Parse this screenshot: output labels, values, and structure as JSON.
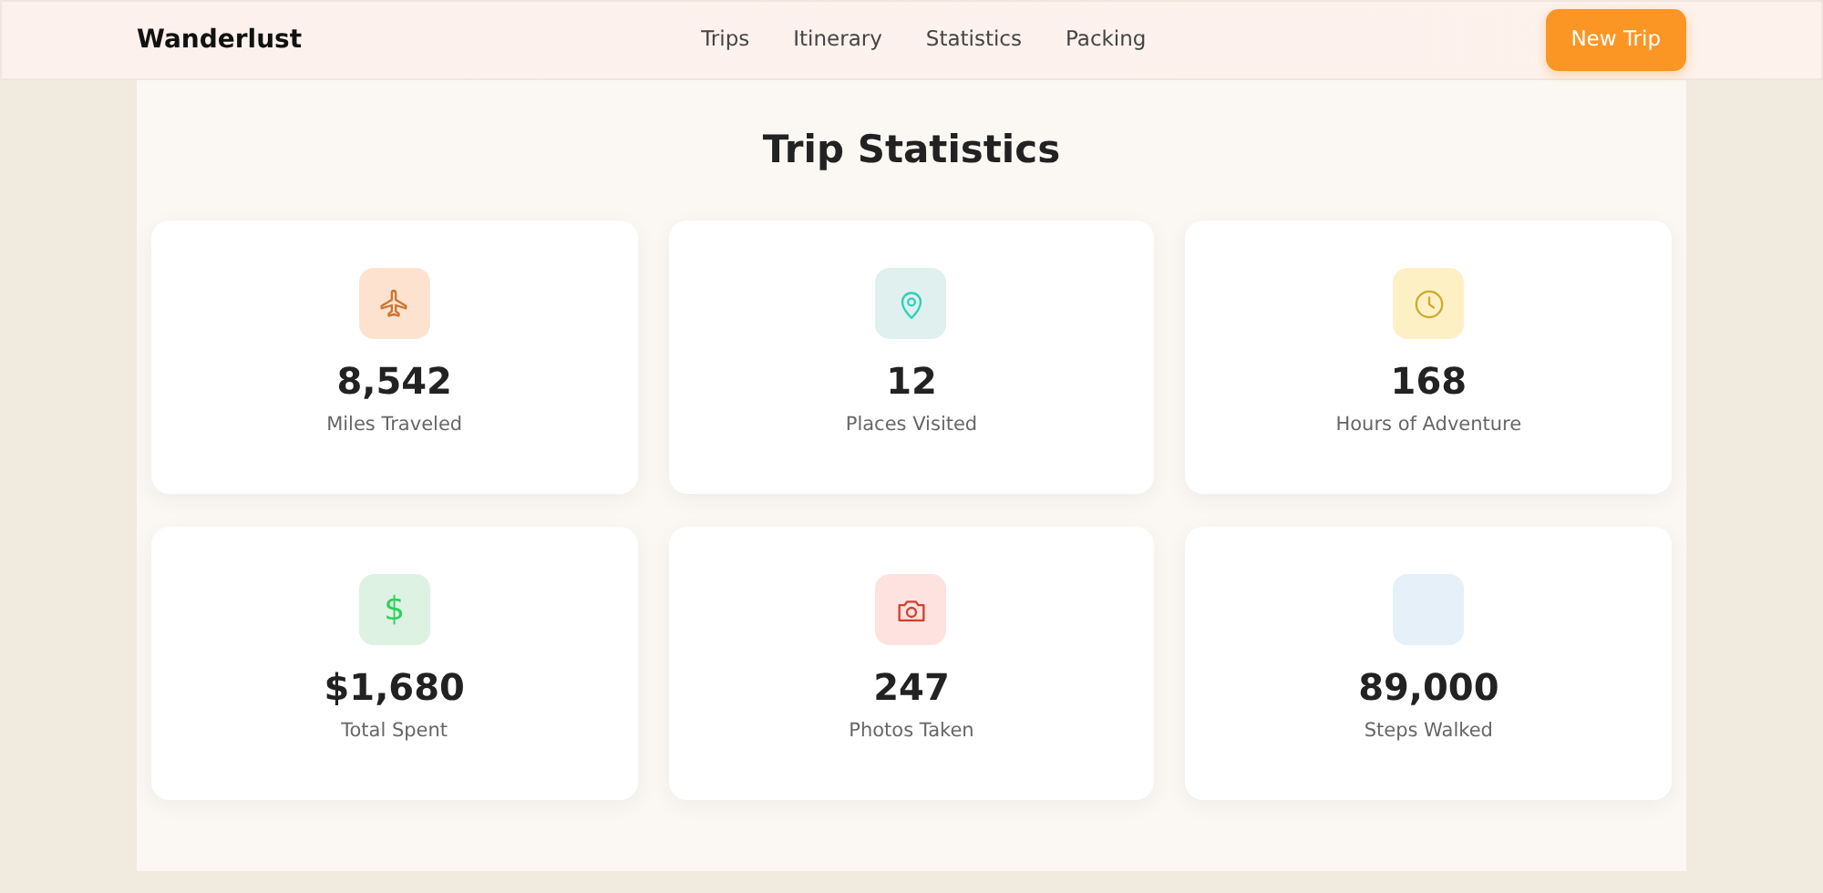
{
  "brand": "Wanderlust",
  "nav": [
    {
      "label": "Trips"
    },
    {
      "label": "Itinerary"
    },
    {
      "label": "Statistics"
    },
    {
      "label": "Packing"
    }
  ],
  "cta": "New Trip",
  "title": "Trip Statistics",
  "stats": [
    {
      "kind": "plane",
      "color": "#fde3cf",
      "value": "8,542",
      "label": "Miles Traveled"
    },
    {
      "kind": "pin",
      "color": "#dff0ee",
      "value": "12",
      "label": "Places Visited"
    },
    {
      "kind": "clock",
      "color": "#fdf0c4",
      "value": "168",
      "label": "Hours of Adventure"
    },
    {
      "kind": "glyph",
      "glyph": "$",
      "color": "#ddf2e3",
      "value": "$1,680",
      "label": "Total Spent"
    },
    {
      "kind": "camera",
      "color": "#fde2df",
      "value": "247",
      "label": "Photos Taken"
    },
    {
      "kind": "blank",
      "color": "#e6f0f8",
      "value": "89,000",
      "label": "Steps Walked"
    }
  ]
}
